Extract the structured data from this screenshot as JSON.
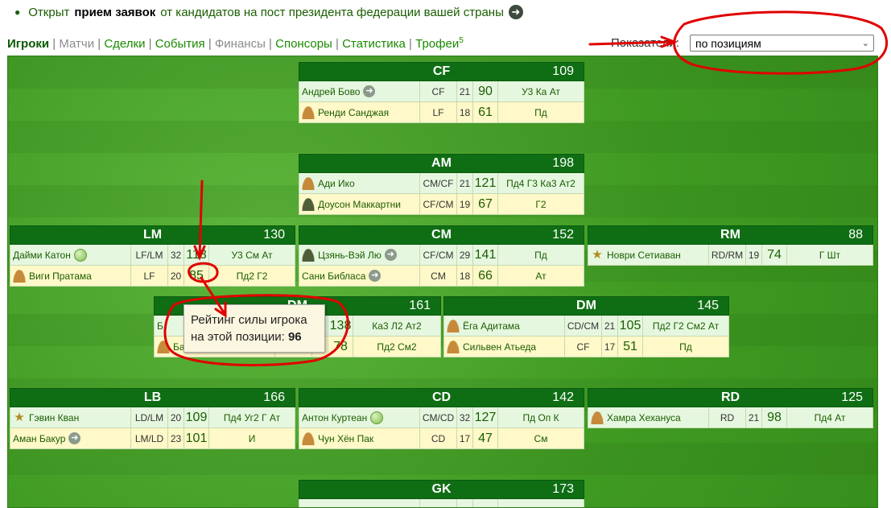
{
  "notice": {
    "prefix": "Открыт",
    "bold": "прием заявок",
    "suffix": "от кандидатов на пост президента федерации вашей страны"
  },
  "nav": {
    "tabs": [
      {
        "label": "Игроки"
      },
      {
        "label": "Матчи"
      },
      {
        "label": "Сделки"
      },
      {
        "label": "События"
      },
      {
        "label": "Финансы"
      },
      {
        "label": "Спонсоры"
      },
      {
        "label": "Статистика"
      },
      {
        "label": "Трофеи",
        "sup": "5"
      }
    ]
  },
  "view": {
    "label": "Показатели:",
    "selected": "по позициям"
  },
  "positions": {
    "cf": {
      "code": "CF",
      "total": "109",
      "players": [
        {
          "name": "Андрей Бово",
          "pos": "CF",
          "age": "21",
          "rating": "90",
          "skills": "У3 Ка Ат"
        },
        {
          "name": "Ренди Санджая",
          "pos": "LF",
          "age": "18",
          "rating": "61",
          "skills": "Пд"
        }
      ]
    },
    "am": {
      "code": "AM",
      "total": "198",
      "players": [
        {
          "name": "Ади Ико",
          "pos": "CM/CF",
          "age": "21",
          "rating": "121",
          "skills": "Пд4 Г3 Ка3 Ат2"
        },
        {
          "name": "Доусон Маккартни",
          "pos": "CF/CM",
          "age": "19",
          "rating": "67",
          "skills": "Г2"
        }
      ]
    },
    "lm": {
      "code": "LM",
      "total": "130",
      "players": [
        {
          "name": "Дайми Катон",
          "pos": "LF/LM",
          "age": "32",
          "rating": "113",
          "skills": "У3 См Ат"
        },
        {
          "name": "Виги Пратама",
          "pos": "LF",
          "age": "20",
          "rating": "85",
          "skills": "Пд2 Г2"
        }
      ]
    },
    "cm": {
      "code": "CM",
      "total": "152",
      "players": [
        {
          "name": "Цзянь-Вэй Лю",
          "pos": "CF/CM",
          "age": "29",
          "rating": "141",
          "skills": "Пд"
        },
        {
          "name": "Сани Библаса",
          "pos": "CM",
          "age": "18",
          "rating": "66",
          "skills": "Ат"
        }
      ]
    },
    "rm": {
      "code": "RM",
      "total": "88",
      "players": [
        {
          "name": "Новри Сетиаван",
          "pos": "RD/RM",
          "age": "19",
          "rating": "74",
          "skills": "Г Шт"
        }
      ]
    },
    "dmleft": {
      "code": "DM",
      "total": "161",
      "players": [
        {
          "name": "Б",
          "pos": "",
          "age": "",
          "rating": "138",
          "skills": "Ка3 Л2 Ат2"
        },
        {
          "name": "Ба",
          "pos": "",
          "age": "",
          "rating": "78",
          "skills": "Пд2 См2"
        }
      ]
    },
    "dm": {
      "code": "DM",
      "total": "145",
      "players": [
        {
          "name": "Ёга Адитама",
          "pos": "CD/CM",
          "age": "21",
          "rating": "105",
          "skills": "Пд2 Г2 См2 Ат"
        },
        {
          "name": "Сильвен Атьеда",
          "pos": "CF",
          "age": "17",
          "rating": "51",
          "skills": "Пд"
        }
      ]
    },
    "lb": {
      "code": "LB",
      "total": "166",
      "players": [
        {
          "name": "Гэвин Кван",
          "pos": "LD/LM",
          "age": "20",
          "rating": "109",
          "skills": "Пд4 Уг2 Г Ат"
        },
        {
          "name": "Аман Бакур",
          "pos": "LM/LD",
          "age": "23",
          "rating": "101",
          "skills": "И"
        }
      ]
    },
    "cd": {
      "code": "CD",
      "total": "142",
      "players": [
        {
          "name": "Антон Куртеан",
          "pos": "CM/CD",
          "age": "32",
          "rating": "127",
          "skills": "Пд Оп К"
        },
        {
          "name": "Чун Хён Пак",
          "pos": "CD",
          "age": "17",
          "rating": "47",
          "skills": "См"
        }
      ]
    },
    "rd": {
      "code": "RD",
      "total": "125",
      "players": [
        {
          "name": "Хамра Хехануса",
          "pos": "RD",
          "age": "21",
          "rating": "98",
          "skills": "Пд4 Ат"
        }
      ]
    },
    "gk": {
      "code": "GK",
      "total": "173"
    }
  },
  "tooltip": {
    "line1": "Рейтинг силы игрока",
    "line2": "на этой позиции:",
    "value": "96"
  },
  "annotations": {
    "color": "#e00000"
  }
}
